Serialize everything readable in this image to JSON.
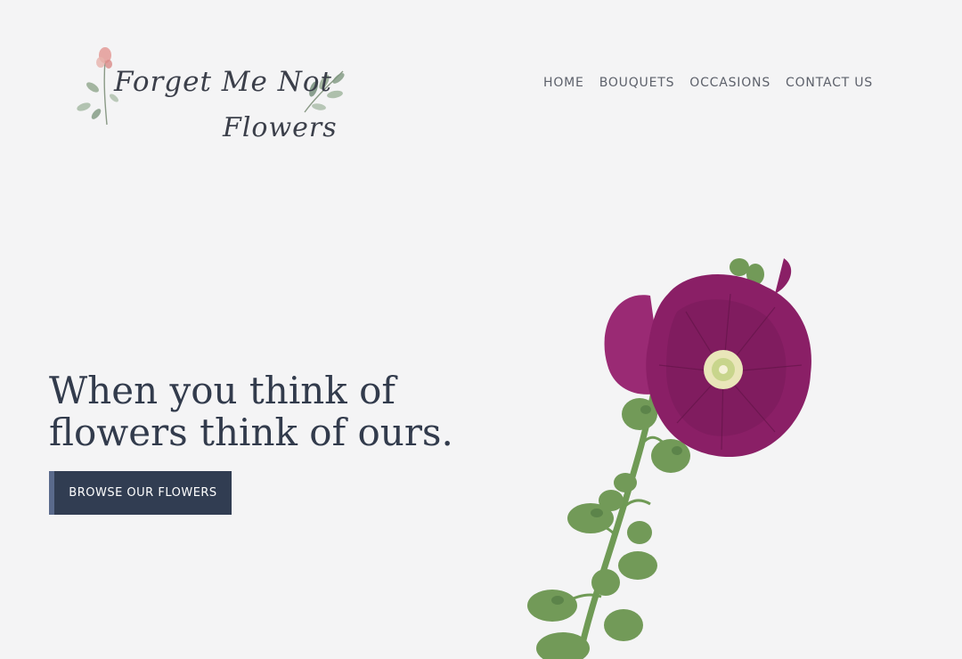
{
  "logo": {
    "line1": "Forget Me Not",
    "line2": "Flowers"
  },
  "nav": {
    "items": [
      "HOME",
      "BOUQUETS",
      "OCCASIONS",
      "CONTACT US"
    ]
  },
  "hero": {
    "headline_line1": "When you think of",
    "headline_line2": "flowers think of ours.",
    "cta_label": "BROWSE OUR FLOWERS"
  },
  "colors": {
    "background": "#f4f4f5",
    "heading": "#323b4c",
    "button": "#313d52",
    "nav_text": "#5d616b",
    "flower_petal": "#8a1f66",
    "stem": "#6f9a55"
  },
  "icons": {
    "logo_decoration": "watercolor-sprig-icon",
    "hero_image": "hollyhock-flower-image"
  }
}
